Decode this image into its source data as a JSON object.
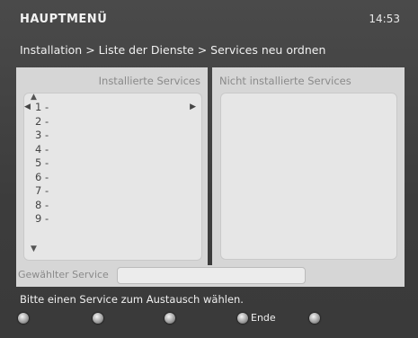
{
  "header": {
    "title": "HAUPTMENÜ",
    "clock": "14:53"
  },
  "breadcrumb": "Installation > Liste der Dienste > Services neu ordnen",
  "panels": {
    "installed_title": "Installierte Services",
    "not_installed_title": "Nicht installierte Services"
  },
  "installed_list": [
    "1 -",
    "2 -",
    "3 -",
    "4 -",
    "5 -",
    "6 -",
    "7 -",
    "8 -",
    "9 -"
  ],
  "selected_service": {
    "label": "Gewählter Service",
    "value": ""
  },
  "hint": "Bitte einen Service zum Austausch wählen.",
  "function_keys": [
    {
      "icon": "red-key-icon",
      "label": ""
    },
    {
      "icon": "green-key-icon",
      "label": ""
    },
    {
      "icon": "yellow-key-icon",
      "label": ""
    },
    {
      "icon": "blue-key-icon",
      "label": "Ende"
    },
    {
      "icon": "white-key-icon",
      "label": ""
    }
  ]
}
